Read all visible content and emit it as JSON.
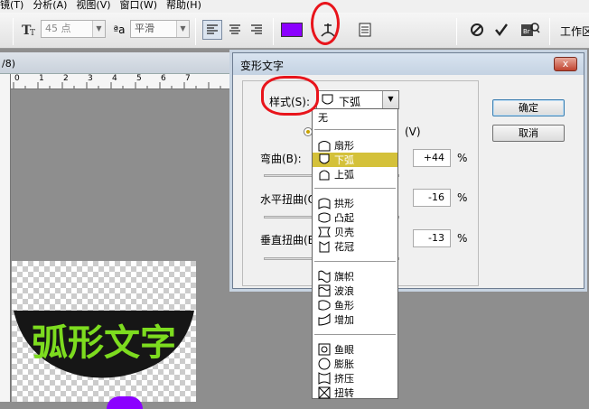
{
  "menubar": {
    "items": [
      "镜(T)",
      "分析(A)",
      "视图(V)",
      "窗口(W)",
      "帮助(H)"
    ]
  },
  "toolbar": {
    "font_size": "45 点",
    "aa_label": "ªa",
    "aa_value": "平滑",
    "color": "#8b00ff",
    "workspace": "工作区"
  },
  "document": {
    "tab_label": "/8)",
    "ruler_marks": [
      "0",
      "1",
      "2",
      "3",
      "4",
      "5",
      "6",
      "7"
    ],
    "artwork_text": "弧形文字",
    "artwork_fill": "#7ddc1f",
    "artwork_shape_fill": "#161616"
  },
  "dialog": {
    "title": "变形文字",
    "close_label": "x",
    "style_label": "样式(S):",
    "style_value": "下弧",
    "radio_suffix": "(V)",
    "bend_label": "弯曲(B):",
    "bend_value": "+44",
    "hdist_label": "水平扭曲(O",
    "hdist_value": "-16",
    "vdist_label": "垂直扭曲(E",
    "vdist_value": "-13",
    "percent": "%",
    "ok": "确定",
    "cancel": "取消"
  },
  "dropdown": {
    "none": "无",
    "items": [
      "扇形",
      "下弧",
      "上弧",
      "拱形",
      "凸起",
      "贝壳",
      "花冠",
      "旗帜",
      "波浪",
      "鱼形",
      "增加",
      "鱼眼",
      "膨胀",
      "挤压",
      "扭转"
    ],
    "selected": "下弧",
    "selected_color": "#d4c13a"
  }
}
